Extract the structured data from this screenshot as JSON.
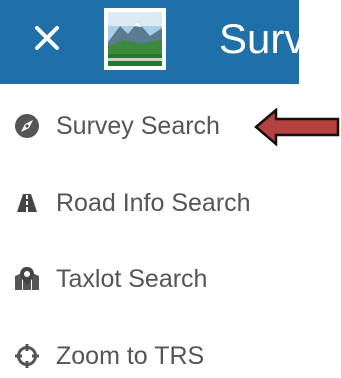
{
  "header": {
    "title": "Surv",
    "close_icon": "close-icon",
    "logo_icon": "landscape-logo",
    "background_color": "#1f6fa9"
  },
  "menu": {
    "items": [
      {
        "label": "Survey Search",
        "icon": "compass-icon"
      },
      {
        "label": "Road Info Search",
        "icon": "road-icon"
      },
      {
        "label": "Taxlot Search",
        "icon": "map-marker-icon"
      },
      {
        "label": "Zoom to TRS",
        "icon": "crosshair-icon"
      }
    ]
  },
  "annotation": {
    "arrow_color": "#b5423f",
    "arrow_points_to": "Survey Search"
  }
}
